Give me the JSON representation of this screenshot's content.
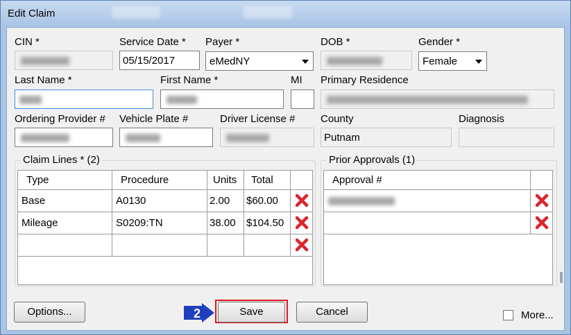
{
  "window": {
    "title": "Edit Claim"
  },
  "form": {
    "cin": {
      "label": "CIN *"
    },
    "service_date": {
      "label": "Service Date *",
      "value": "05/15/2017"
    },
    "payer": {
      "label": "Payer *",
      "value": "eMedNY"
    },
    "dob": {
      "label": "DOB *"
    },
    "gender": {
      "label": "Gender *",
      "value": "Female"
    },
    "last_name": {
      "label": "Last Name *"
    },
    "first_name": {
      "label": "First Name *"
    },
    "mi": {
      "label": "MI"
    },
    "primary_residence": {
      "label": "Primary Residence"
    },
    "ordering_provider": {
      "label": "Ordering Provider #"
    },
    "vehicle_plate": {
      "label": "Vehicle Plate #"
    },
    "driver_license": {
      "label": "Driver License #"
    },
    "county": {
      "label": "County",
      "value": "Putnam"
    },
    "diagnosis": {
      "label": "Diagnosis"
    }
  },
  "claim_lines": {
    "title": "Claim Lines * (2)",
    "columns": [
      "Type",
      "Procedure",
      "Units",
      "Total"
    ],
    "rows": [
      {
        "type": "Base",
        "procedure": "A0130",
        "units": "2.00",
        "total": "$60.00"
      },
      {
        "type": "Mileage",
        "procedure": "S0209:TN",
        "units": "38.00",
        "total": "$104.50"
      },
      {
        "type": "",
        "procedure": "",
        "units": "",
        "total": ""
      }
    ]
  },
  "prior_approvals": {
    "title": "Prior Approvals (1)",
    "columns": [
      "Approval #"
    ]
  },
  "buttons": {
    "options": "Options...",
    "save": "Save",
    "cancel": "Cancel",
    "more": "More..."
  },
  "annotation": {
    "step": "2"
  },
  "colors": {
    "delete_icon": "#d9262c",
    "highlight": "#e0191f",
    "badge": "#1f3fbf"
  }
}
